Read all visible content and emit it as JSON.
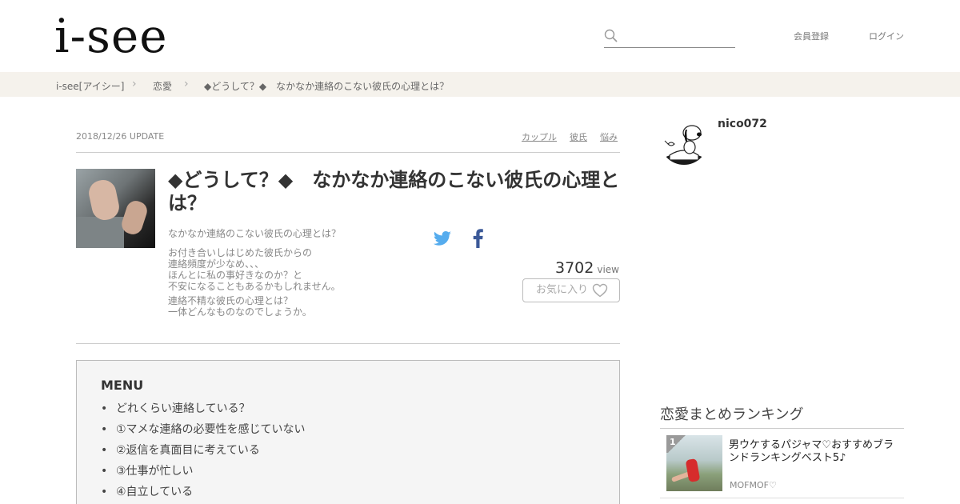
{
  "header": {
    "logo": "i-see",
    "search_placeholder": "",
    "register_label": "会員登録",
    "login_label": "ログイン"
  },
  "breadcrumb": {
    "items": [
      "i-see[アイシー]",
      "恋愛",
      "◆どうして？◆　なかなか連絡のこない彼氏の心理とは？"
    ],
    "separator": "›"
  },
  "article": {
    "date": "2018/12/26 UPDATE",
    "tags": [
      "カップル",
      "彼氏",
      "悩み"
    ],
    "title": "◆どうして？◆　なかなか連絡のこない彼氏の心理とは？",
    "description": [
      [
        "なかなか連絡のこない彼氏の心理とは？"
      ],
      [
        "お付き合いしはじめた彼氏からの",
        "連絡頻度が少なめ、、、",
        "ほんとに私の事好きなのか？と",
        "不安になることもあるかもしれません。"
      ],
      [
        "連絡不精な彼氏の心理とは？",
        "一体どんなものなのでしょうか。"
      ]
    ],
    "views": "3702",
    "views_unit": "view",
    "favorite_label": "お気に入り"
  },
  "menu": {
    "title": "MENU",
    "items": [
      "どれくらい連絡している？",
      "①マメな連絡の必要性を感じていない",
      "②返信を真面目に考えている",
      "③仕事が忙しい",
      "④自立している"
    ]
  },
  "sidebar": {
    "username": "nico072",
    "ranking_title": "恋愛まとめランキング",
    "ranking": [
      {
        "rank": "1",
        "title": "男ウケするパジャマ♡おすすめブランドランキングベスト5♪",
        "author": "MOFMOF♡"
      }
    ]
  },
  "colors": {
    "breadcrumb_bg": "#f5f2ec",
    "twitter": "#55acee",
    "facebook": "#3b5998"
  }
}
